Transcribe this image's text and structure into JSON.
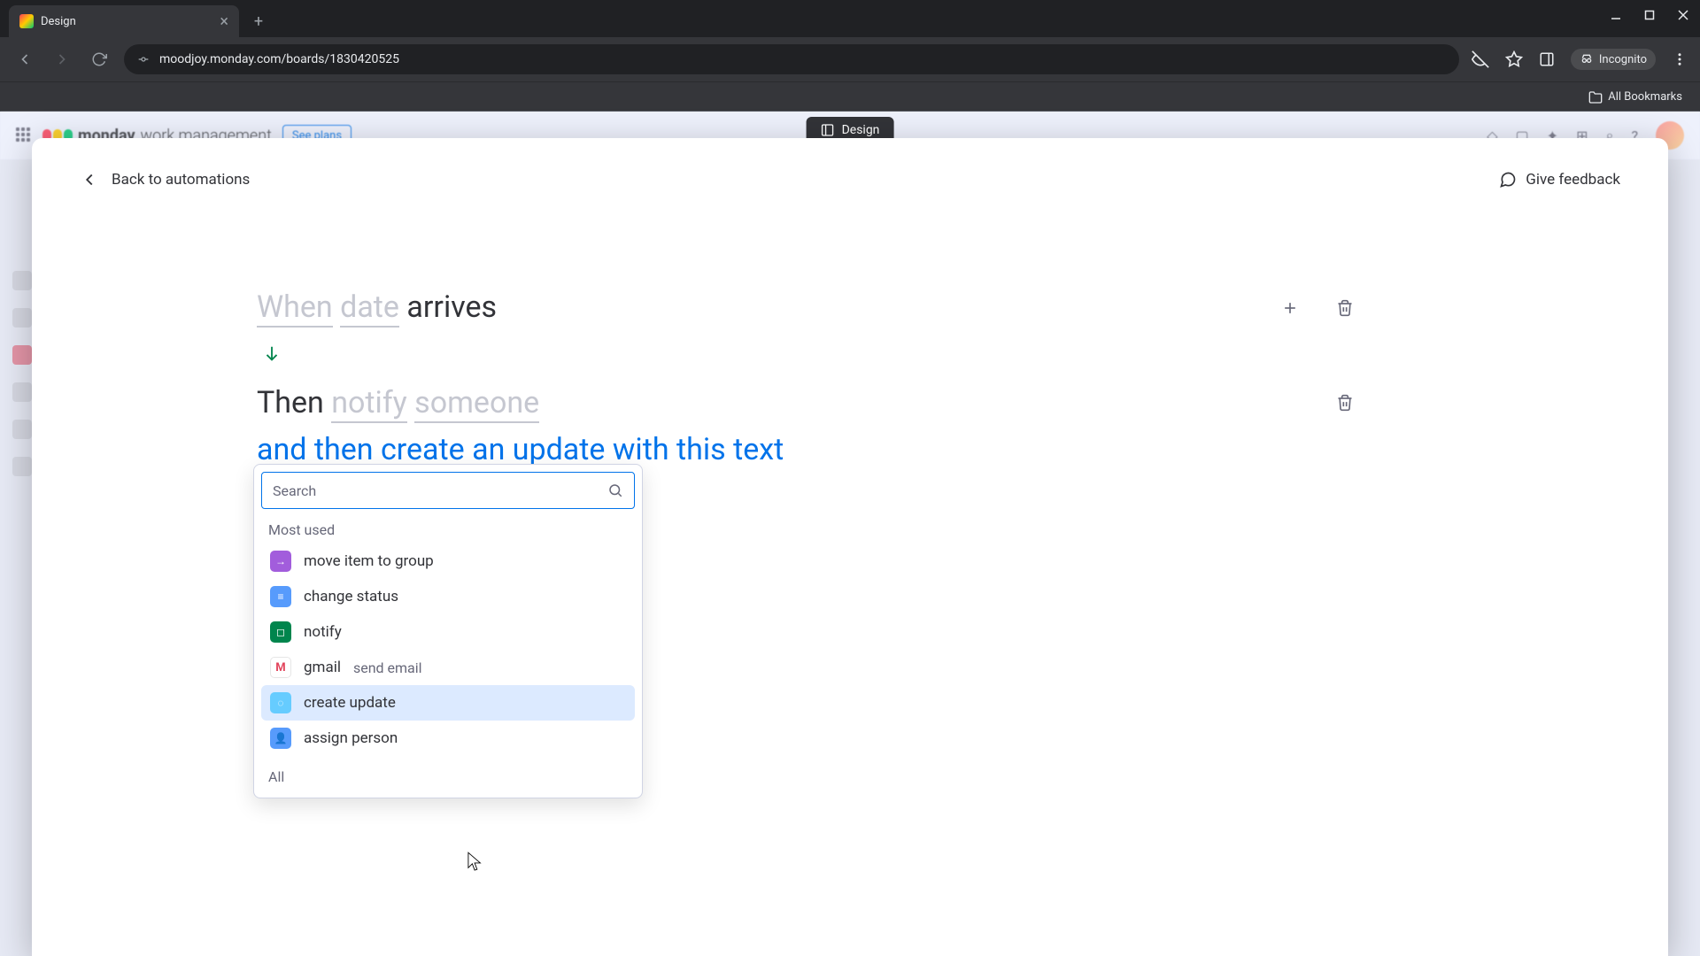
{
  "browser": {
    "tab_title": "Design",
    "url": "moodjoy.monday.com/boards/1830420525",
    "incognito_label": "Incognito",
    "bookmarks_label": "All Bookmarks"
  },
  "monday_header": {
    "brand_primary": "monday",
    "brand_secondary": "work management",
    "see_plans": "See plans",
    "center_pill": "Design"
  },
  "modal": {
    "back_label": "Back to automations",
    "feedback_label": "Give feedback"
  },
  "builder": {
    "trigger": {
      "when": "When",
      "date": "date",
      "arrives": "arrives"
    },
    "action1": {
      "then": "Then",
      "notify": "notify",
      "someone": "someone"
    },
    "action2_full": "and then create an update with this text"
  },
  "dropdown": {
    "search_placeholder": "Search",
    "section_most_used": "Most used",
    "section_all": "All",
    "options": [
      {
        "label": "move item to group",
        "sub": ""
      },
      {
        "label": "change status",
        "sub": ""
      },
      {
        "label": "notify",
        "sub": ""
      },
      {
        "label": "gmail",
        "sub": "send email"
      },
      {
        "label": "create update",
        "sub": ""
      },
      {
        "label": "assign person",
        "sub": ""
      }
    ]
  }
}
